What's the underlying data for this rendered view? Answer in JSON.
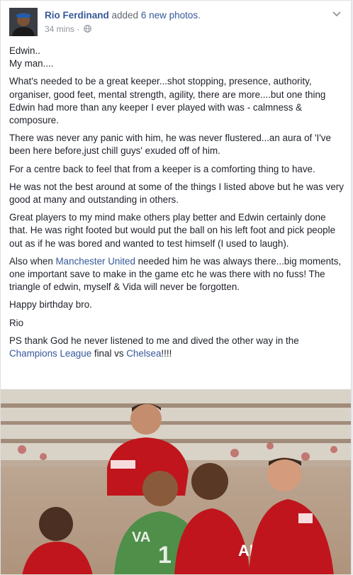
{
  "post": {
    "author": "Rio Ferdinand",
    "action_prefix": "added ",
    "action_highlight": "6 new photos",
    "action_suffix": ".",
    "time": "34 mins",
    "separator": "·"
  },
  "body": {
    "p1_line1": "Edwin..",
    "p1_line2": "My man....",
    "p2": "What's needed to be a great keeper...shot stopping, presence, authority, organiser, good feet, mental strength, agility, there are more....but one thing Edwin had more than any keeper I ever played with was - calmness & composure.",
    "p3": "There was never any panic with him, he was never flustered...an aura of 'I've been here before,just chill guys' exuded off of him.",
    "p4": "For a centre back to feel that from a keeper is a comforting thing to have.",
    "p5": "He was not the best around at some of the things I listed above but he was very good at many and outstanding in others.",
    "p6": "Great players to my mind make others play better and Edwin certainly done that. He was right footed but would put the ball on his left foot and pick people out as if he was bored and wanted to test himself (I used to laugh).",
    "p7_pre": "Also when ",
    "p7_link": "Manchester United",
    "p7_post": " needed him he was always there...big moments, one important save to make in the game etc he was there with no fuss! The triangle of edwin, myself & Vida will never be forgotten.",
    "p8": "Happy birthday bro.",
    "p9": "Rio",
    "p10_pre": "PS thank God he never listened to me and dived the other way in the ",
    "p10_link1": "Champions League",
    "p10_mid": " final vs ",
    "p10_link2": "Chelsea",
    "p10_post": "!!!!"
  },
  "photo": {
    "jersey_text_left": "VA",
    "jersey_text_number": "1",
    "jersey_text_sponsor": "AIG"
  },
  "colors": {
    "link": "#365899",
    "text": "#1d2129",
    "meta": "#90949c",
    "shirt_red": "#c0151c",
    "keeper_green": "#4f8f4a"
  },
  "icons": {
    "privacy": "globe-icon",
    "menu": "chevron-down-icon",
    "avatar": "avatar"
  }
}
